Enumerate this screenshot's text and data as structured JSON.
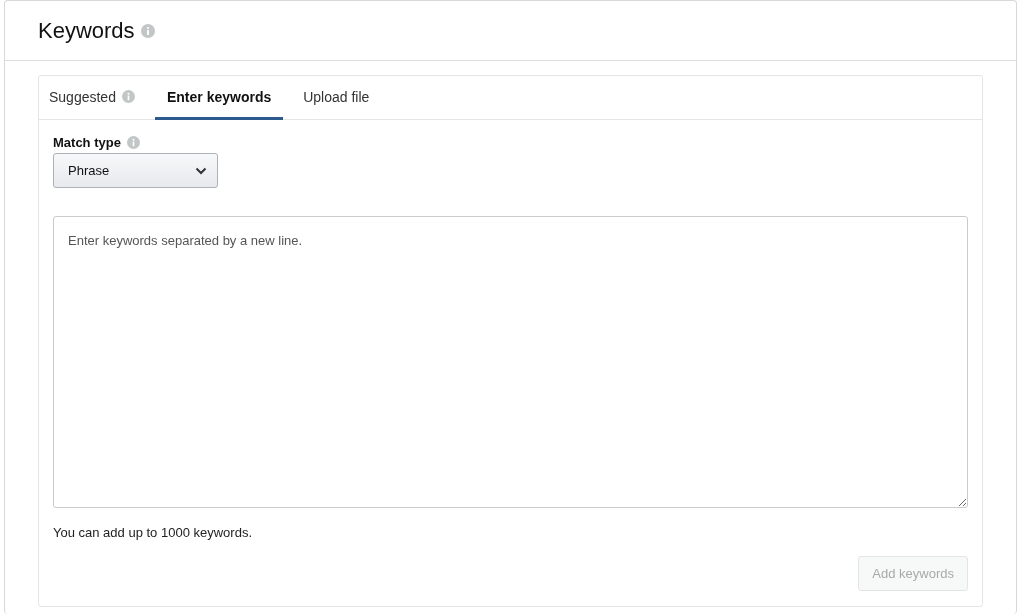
{
  "section": {
    "title": "Keywords",
    "info": true
  },
  "tabs": [
    {
      "label": "Suggested",
      "selected": false,
      "info": true
    },
    {
      "label": "Enter keywords",
      "selected": true,
      "info": false
    },
    {
      "label": "Upload file",
      "selected": false,
      "info": false
    }
  ],
  "match_type": {
    "label": "Match type",
    "info": true,
    "value": "Phrase"
  },
  "keywords_field": {
    "placeholder": "Enter keywords separated by a new line."
  },
  "hint": "You can add up to 1000 keywords.",
  "add_button": {
    "label": "Add keywords",
    "disabled": true
  }
}
